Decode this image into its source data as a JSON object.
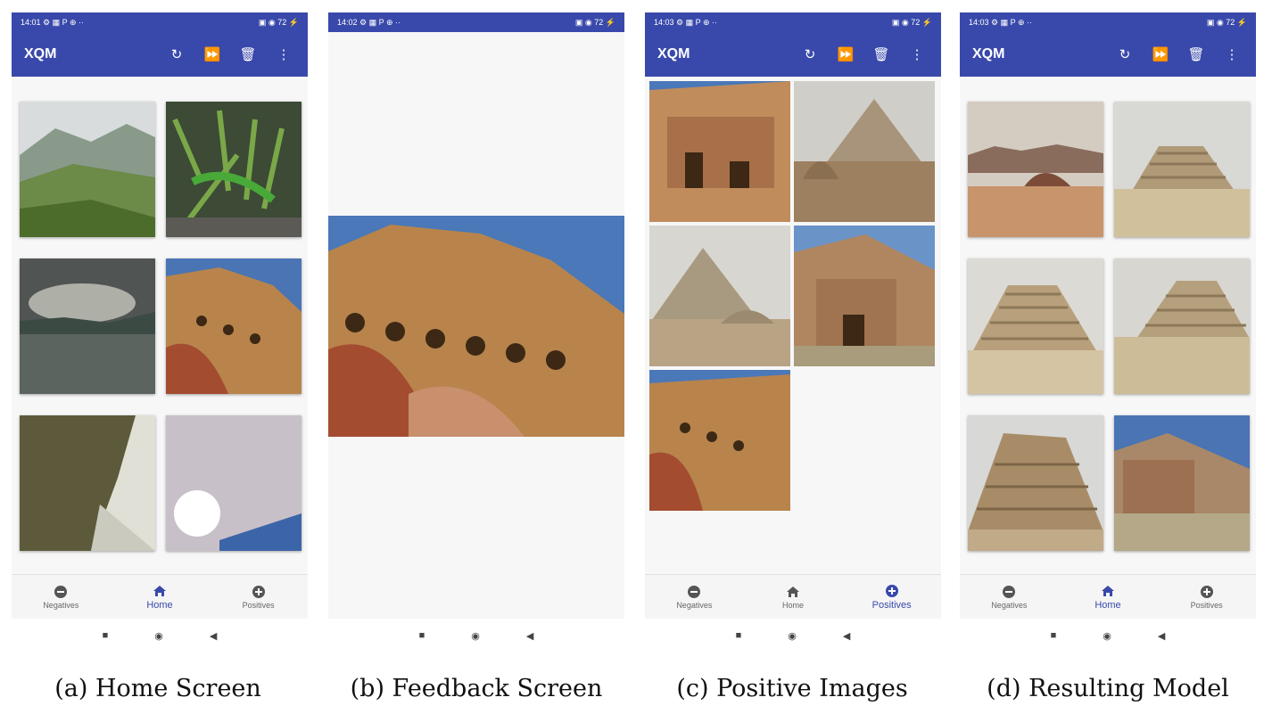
{
  "colors": {
    "primary": "#3949ab",
    "background": "#f7f7f7",
    "inactive": "#666666"
  },
  "phones": [
    {
      "status": {
        "time": "14:01",
        "icons_left": "⚙ ▦ P ⊕ ··",
        "icons_right": "▣ ◉ 72 ⚡",
        "battery": "72"
      },
      "app_title": "XQM",
      "actions": [
        "refresh-icon",
        "fast-forward-icon",
        "delete-icon",
        "more-vert-icon"
      ],
      "nav": [
        {
          "label": "Negatives",
          "icon": "minus-circle-icon"
        },
        {
          "label": "Home",
          "icon": "home-icon"
        },
        {
          "label": "Positives",
          "icon": "plus-circle-icon"
        }
      ],
      "active_nav": "Home",
      "caption": "(a) Home Screen"
    },
    {
      "status": {
        "time": "14:02",
        "icons_left": "⚙ ▦ P ⊕ ··",
        "icons_right": "▣ ◉ 72 ⚡",
        "battery": "72"
      },
      "caption": "(b) Feedback Screen"
    },
    {
      "status": {
        "time": "14:03",
        "icons_left": "⚙ ▦ P ⊕ ··",
        "icons_right": "▣ ◉ 72 ⚡",
        "battery": "72"
      },
      "app_title": "XQM",
      "actions": [
        "refresh-icon",
        "fast-forward-icon",
        "delete-icon",
        "more-vert-icon"
      ],
      "nav": [
        {
          "label": "Negatives",
          "icon": "minus-circle-icon"
        },
        {
          "label": "Home",
          "icon": "home-icon"
        },
        {
          "label": "Positives",
          "icon": "plus-circle-icon"
        }
      ],
      "active_nav": "Positives",
      "caption": "(c) Positive Images"
    },
    {
      "status": {
        "time": "14:03",
        "icons_left": "⚙ ▦ P ⊕ ··",
        "icons_right": "▣ ◉ 72 ⚡",
        "battery": "72"
      },
      "app_title": "XQM",
      "actions": [
        "refresh-icon",
        "fast-forward-icon",
        "delete-icon",
        "more-vert-icon"
      ],
      "nav": [
        {
          "label": "Negatives",
          "icon": "minus-circle-icon"
        },
        {
          "label": "Home",
          "icon": "home-icon"
        },
        {
          "label": "Positives",
          "icon": "plus-circle-icon"
        }
      ],
      "active_nav": "Home",
      "caption": "(d) Resulting Model"
    }
  ],
  "system_nav": [
    "recents-icon",
    "home-circle-icon",
    "back-icon"
  ]
}
